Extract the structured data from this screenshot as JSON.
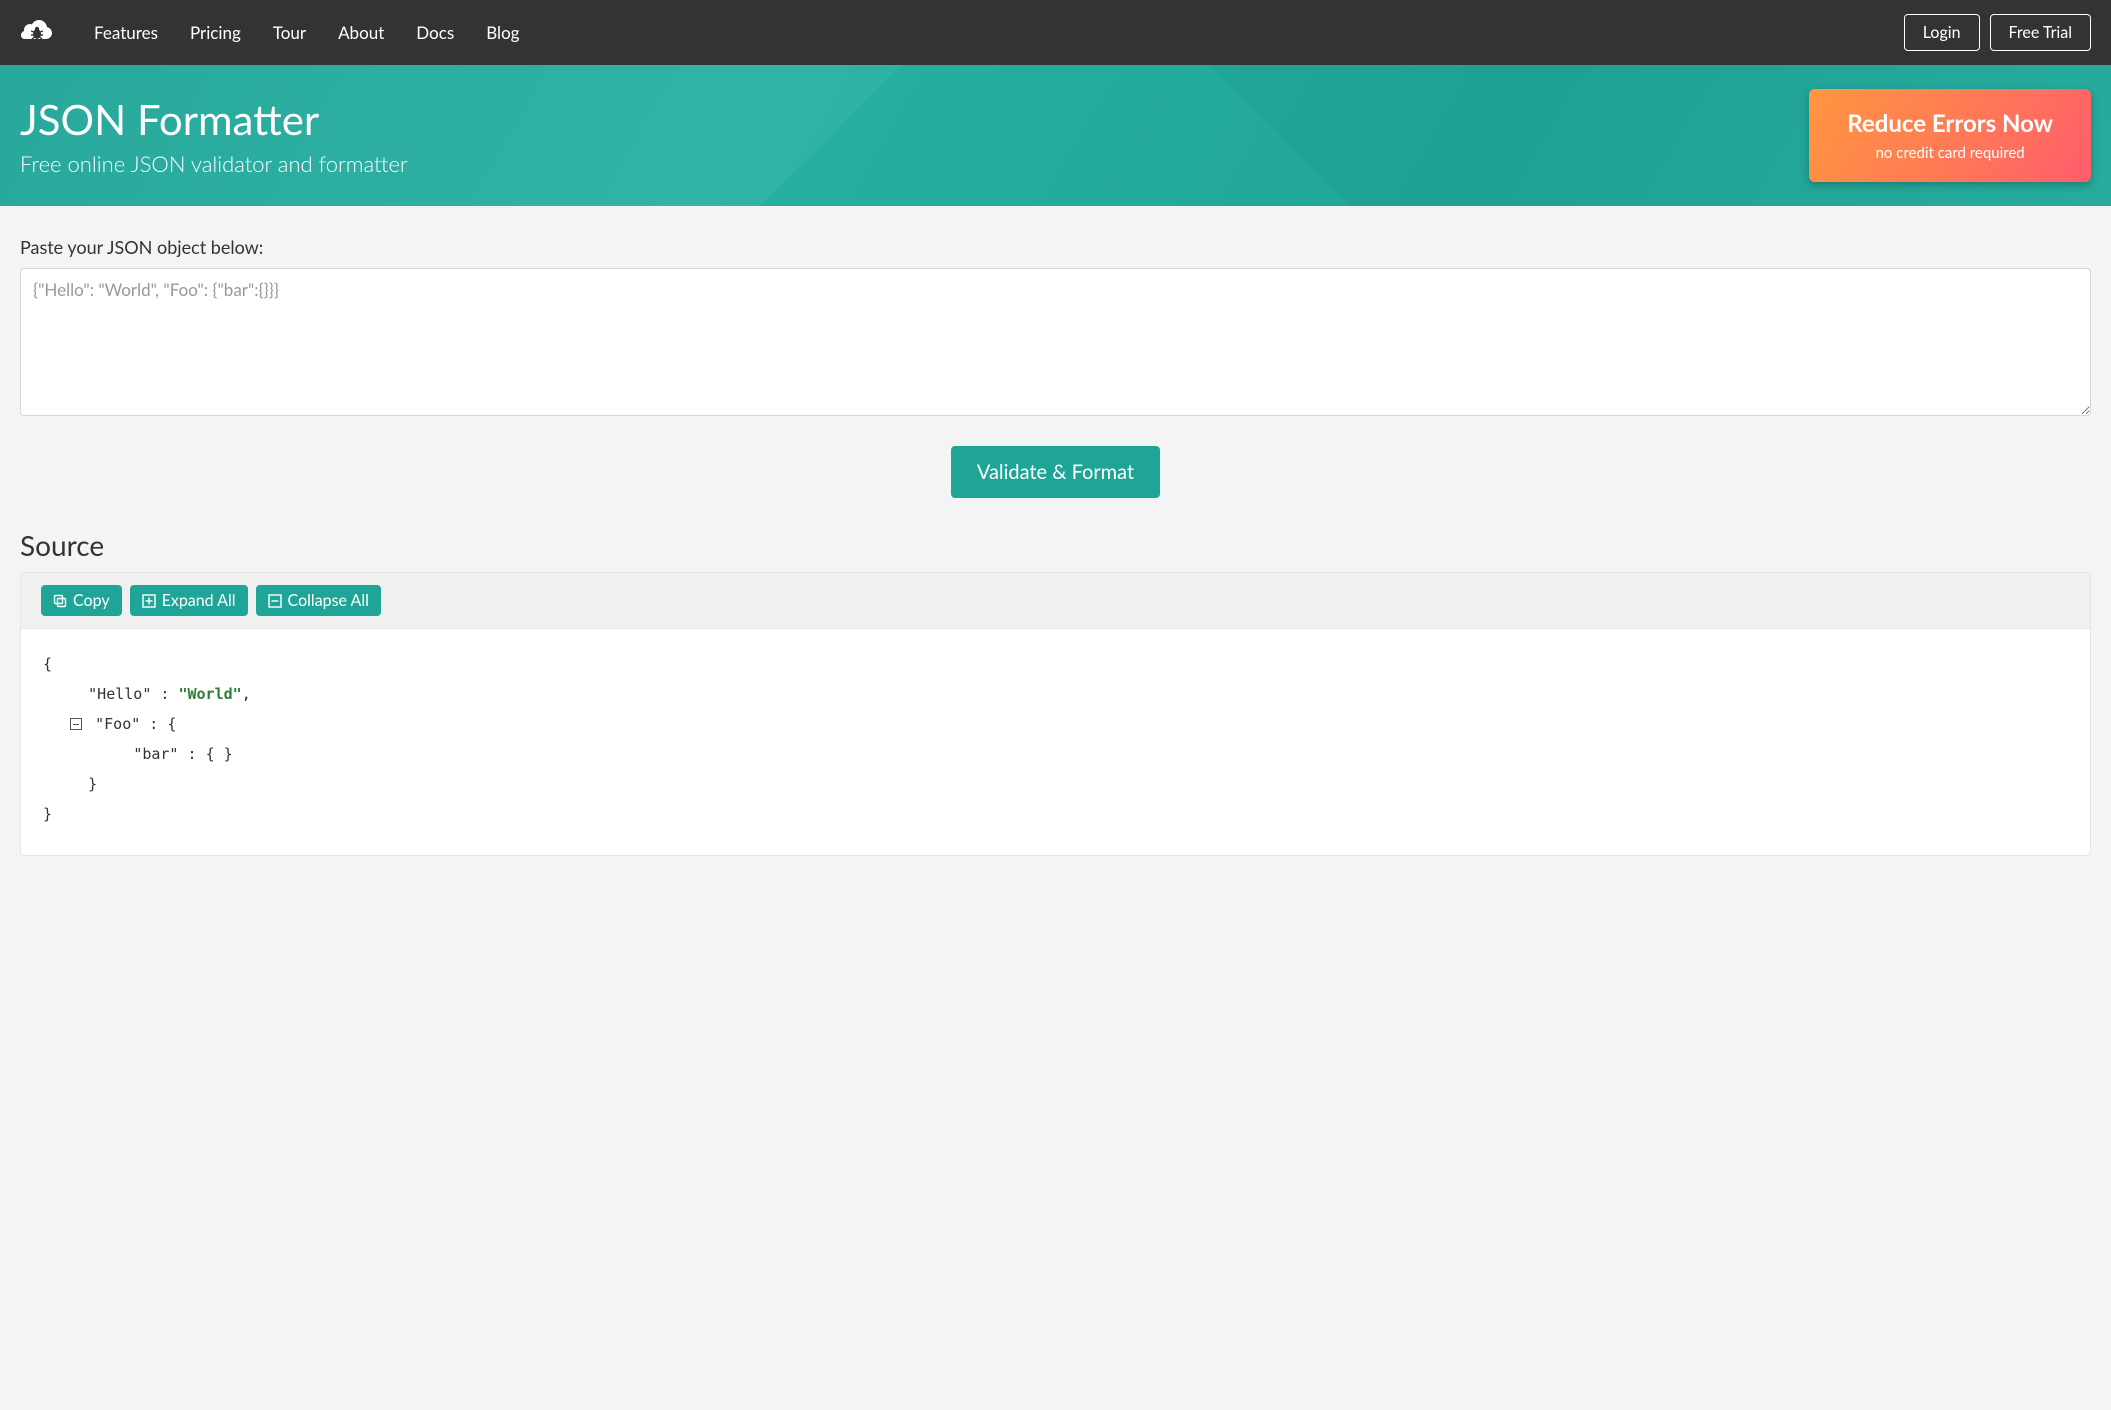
{
  "nav": {
    "links": [
      "Features",
      "Pricing",
      "Tour",
      "About",
      "Docs",
      "Blog"
    ],
    "login": "Login",
    "free_trial": "Free Trial"
  },
  "hero": {
    "title": "JSON Formatter",
    "subtitle": "Free online JSON validator and formatter",
    "cta_title": "Reduce Errors Now",
    "cta_sub": "no credit card required"
  },
  "input": {
    "label": "Paste your JSON object below:",
    "placeholder": "{\"Hello\": \"World\", \"Foo\": {\"bar\":{}}}"
  },
  "actions": {
    "validate": "Validate & Format"
  },
  "source": {
    "header": "Source",
    "copy": "Copy",
    "expand_all": "Expand All",
    "collapse_all": "Collapse All",
    "lines": {
      "open": "{",
      "hello_key": "\"Hello\"",
      "hello_val": "\"World\"",
      "foo_key": "\"Foo\"",
      "bar_key": "\"bar\"",
      "bar_val": "{ }",
      "close_inner": "}",
      "close_outer": "}"
    }
  },
  "colors": {
    "accent": "#1fa597",
    "navbar": "#333333",
    "cta_gradient_start": "#ff9640",
    "cta_gradient_end": "#ff5d6c"
  }
}
